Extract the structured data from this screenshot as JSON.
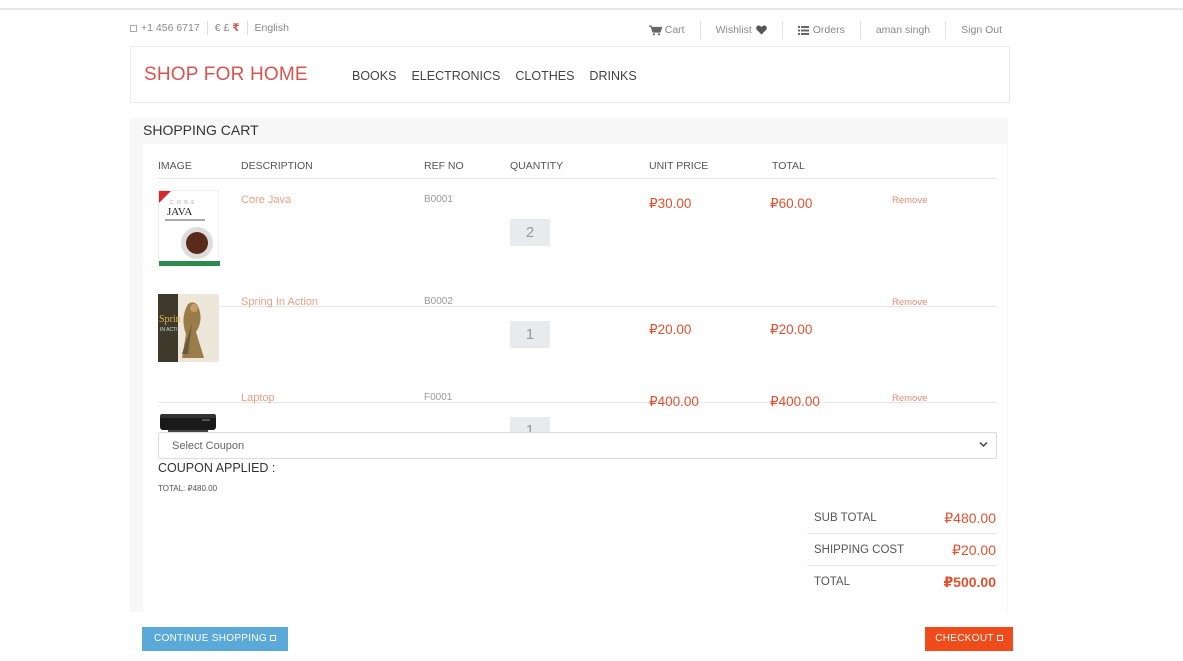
{
  "topbar": {
    "phone": "+1 456 6717",
    "currencies": [
      "€",
      "£",
      "₹"
    ],
    "language": "English",
    "cart": "Cart",
    "wishlist": "Wishlist",
    "orders": "Orders",
    "user": "aman singh",
    "signout": "Sign Out"
  },
  "brand": "SHOP FOR HOME",
  "nav": [
    "BOOKS",
    "ELECTRONICS",
    "CLOTHES",
    "DRINKS"
  ],
  "cart": {
    "title": "SHOPPING CART",
    "headers": {
      "image": "IMAGE",
      "description": "DESCRIPTION",
      "ref": "REF NO",
      "quantity": "QUANTITY",
      "unit_price": "UNIT PRICE",
      "total": "TOTAL"
    },
    "items": [
      {
        "description": "Core Java",
        "ref": "B0001",
        "quantity": "2",
        "unit_price": "₽30.00",
        "total": "₽60.00",
        "remove": "Remove",
        "image_text": "JAVA"
      },
      {
        "description": "Spring In Action",
        "ref": "B0002",
        "quantity": "1",
        "unit_price": "₽20.00",
        "total": "₽20.00",
        "remove": "Remove",
        "image_text": "Sprin"
      },
      {
        "description": "Laptop",
        "ref": "F0001",
        "quantity": "1",
        "unit_price": "₽400.00",
        "total": "₽400.00",
        "remove": "Remove"
      }
    ],
    "coupon_placeholder": "Select Coupon",
    "coupon_applied": "COUPON APPLIED :",
    "total_small": "TOTAL: ₽480.00",
    "summary": {
      "sub_total_label": "SUB TOTAL",
      "sub_total": "₽480.00",
      "shipping_label": "SHIPPING COST",
      "shipping": "₽20.00",
      "total_label": "TOTAL",
      "total": "₽500.00"
    },
    "continue_label": "CONTINUE SHOPPING",
    "checkout_label": "CHECKOUT"
  },
  "colors": {
    "brand": "#d9534f",
    "price": "#e0522f",
    "continue": "#5aa9d9",
    "checkout": "#f04b1a"
  }
}
